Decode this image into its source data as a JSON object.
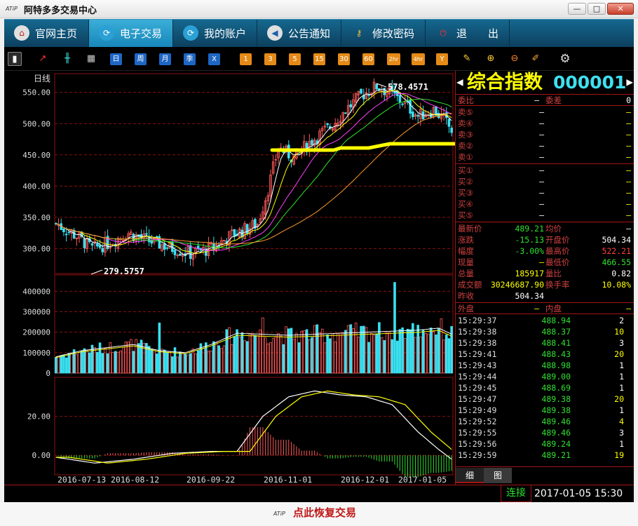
{
  "window": {
    "logo": "ATiP",
    "title": "阿特多多交易中心",
    "min": "—",
    "max": "□",
    "close": "✕"
  },
  "nav": [
    {
      "label": "官网主页",
      "icon": "home-icon"
    },
    {
      "label": "电子交易",
      "icon": "refresh-icon",
      "active": true
    },
    {
      "label": "我的账户",
      "icon": "refresh-icon"
    },
    {
      "label": "公告通知",
      "icon": "megaphone-icon"
    },
    {
      "label": "修改密码",
      "icon": "key-icon"
    },
    {
      "label": "退　　出",
      "icon": "power-icon"
    }
  ],
  "toolbar": {
    "periods": [
      "日",
      "周",
      "月",
      "季",
      "X"
    ],
    "minutes": [
      "1",
      "3",
      "5",
      "15",
      "30",
      "60",
      "2hr",
      "4hr",
      "Y"
    ]
  },
  "chart_data": {
    "type": "candlestick",
    "period_label": "日线",
    "price_axis": {
      "ticks": [
        "550.00",
        "500.00",
        "450.00",
        "400.00",
        "350.00",
        "300.00"
      ],
      "values": [
        550,
        500,
        450,
        400,
        350,
        300
      ],
      "ylim": [
        260,
        580
      ]
    },
    "volume_axis": {
      "ticks": [
        "400000",
        "300000",
        "200000",
        "100000",
        "0"
      ],
      "values": [
        400000,
        300000,
        200000,
        100000,
        0
      ],
      "ylim": [
        0,
        480000
      ]
    },
    "macd_axis": {
      "ticks": [
        "20.00",
        "0.00"
      ],
      "values": [
        20,
        0
      ],
      "ylim": [
        -10,
        40
      ]
    },
    "x_labels": [
      "2016-07-13",
      "2016-08-12",
      "2016-09-22",
      "2016-11-01",
      "2016-12-01",
      "2017-01-05"
    ],
    "annotations": [
      {
        "text": "578.4571",
        "kind": "high"
      },
      {
        "text": "279.5757",
        "kind": "low"
      }
    ],
    "colors": {
      "up": "#ff5a5a",
      "down": "#3ae0f0",
      "ma1": "#ffffff",
      "ma2": "#ffff00",
      "ma3": "#ff40ff",
      "ma4": "#30e030",
      "ma5": "#ff9a30",
      "highlight": "#ffff00",
      "grid": "#8a1010"
    },
    "series": [
      {
        "kp": [
          0,
          342
        ],
        "kp_end": [
          20,
          303
        ]
      },
      {
        "kp": [
          20,
          303
        ],
        "kp_end": [
          40,
          318
        ]
      }
    ],
    "price_keypoints": [
      [
        0,
        340
      ],
      [
        8,
        320
      ],
      [
        14,
        300
      ],
      [
        20,
        308
      ],
      [
        28,
        325
      ],
      [
        36,
        312
      ],
      [
        44,
        302
      ],
      [
        52,
        292
      ],
      [
        60,
        300
      ],
      [
        68,
        322
      ],
      [
        74,
        332
      ],
      [
        78,
        340
      ],
      [
        82,
        395
      ],
      [
        86,
        462
      ],
      [
        92,
        445
      ],
      [
        98,
        470
      ],
      [
        106,
        495
      ],
      [
        112,
        522
      ],
      [
        118,
        545
      ],
      [
        124,
        560
      ],
      [
        128,
        552
      ],
      [
        134,
        535
      ],
      [
        140,
        512
      ],
      [
        146,
        522
      ],
      [
        150,
        507
      ],
      [
        153,
        489
      ]
    ],
    "volume_keypoints": [
      [
        0,
        80000
      ],
      [
        10,
        110000
      ],
      [
        20,
        125000
      ],
      [
        30,
        140000
      ],
      [
        40,
        110000
      ],
      [
        50,
        100000
      ],
      [
        60,
        140000
      ],
      [
        70,
        195000
      ],
      [
        80,
        190000
      ],
      [
        90,
        185000
      ],
      [
        100,
        190000
      ],
      [
        110,
        195000
      ],
      [
        120,
        200000
      ],
      [
        130,
        205000
      ],
      [
        140,
        210000
      ],
      [
        148,
        220000
      ],
      [
        153,
        190000
      ]
    ],
    "macd_keypoints": [
      [
        0,
        -1
      ],
      [
        15,
        -4
      ],
      [
        30,
        -2
      ],
      [
        45,
        1
      ],
      [
        60,
        2
      ],
      [
        70,
        2
      ],
      [
        80,
        20
      ],
      [
        90,
        30
      ],
      [
        100,
        33
      ],
      [
        110,
        31
      ],
      [
        120,
        30
      ],
      [
        130,
        26
      ],
      [
        140,
        12
      ],
      [
        148,
        3
      ],
      [
        153,
        -2
      ]
    ]
  },
  "quote": {
    "name": "综合指数",
    "code": "000001",
    "arrow_left": "◀",
    "arrow_right": "▶",
    "ratio": {
      "label1": "委比",
      "val1": "—",
      "label2": "委差",
      "val2": "0"
    },
    "sell": [
      {
        "label": "卖⑤",
        "price": "—",
        "vol": "—"
      },
      {
        "label": "卖④",
        "price": "—",
        "vol": "—"
      },
      {
        "label": "卖③",
        "price": "—",
        "vol": "—"
      },
      {
        "label": "卖②",
        "price": "—",
        "vol": "—"
      },
      {
        "label": "卖①",
        "price": "—",
        "vol": "—"
      }
    ],
    "buy": [
      {
        "label": "买①",
        "price": "—",
        "vol": "—"
      },
      {
        "label": "买②",
        "price": "—",
        "vol": "—"
      },
      {
        "label": "买③",
        "price": "—",
        "vol": "—"
      },
      {
        "label": "买④",
        "price": "—",
        "vol": "—"
      },
      {
        "label": "买⑤",
        "price": "—",
        "vol": "—"
      }
    ],
    "stats": [
      {
        "l1": "最新价",
        "v1": "489.21",
        "c1": "#30e030",
        "l2": "均价",
        "v2": "—",
        "c2": "#ffffff"
      },
      {
        "l1": "涨跌",
        "v1": "-15.13",
        "c1": "#30e030",
        "l2": "开盘价",
        "v2": "504.34",
        "c2": "#ffffff"
      },
      {
        "l1": "幅度",
        "v1": "-3.00%",
        "c1": "#30e030",
        "l2": "最高价",
        "v2": "522.21",
        "c2": "#ff4040"
      },
      {
        "l1": "现量",
        "v1": "—",
        "c1": "#ffff00",
        "l2": "最低价",
        "v2": "466.55",
        "c2": "#30e030"
      },
      {
        "l1": "总量",
        "v1": "185917",
        "c1": "#ffff00",
        "l2": "量比",
        "v2": "0.82",
        "c2": "#ffffff"
      },
      {
        "l1": "成交额",
        "v1": "30246687.90",
        "c1": "#ffff00",
        "l2": "换手率",
        "v2": "10.08%",
        "c2": "#ffff00"
      },
      {
        "l1": "昨收",
        "v1": "504.34",
        "c1": "#ffffff",
        "l2": "",
        "v2": "",
        "c2": "#ffffff"
      }
    ],
    "outer": {
      "label1": "外盘",
      "val1": "—",
      "label2": "内盘",
      "val2": "—"
    },
    "trades": [
      {
        "time": "15:29:37",
        "price": "488.94",
        "vol": "2",
        "vc": "#ffffff"
      },
      {
        "time": "15:29:38",
        "price": "488.37",
        "vol": "10",
        "vc": "#ffff00"
      },
      {
        "time": "15:29:38",
        "price": "488.41",
        "vol": "3",
        "vc": "#ffffff"
      },
      {
        "time": "15:29:41",
        "price": "488.43",
        "vol": "20",
        "vc": "#ffff00"
      },
      {
        "time": "15:29:43",
        "price": "488.98",
        "vol": "1",
        "vc": "#ffffff"
      },
      {
        "time": "15:29:44",
        "price": "489.00",
        "vol": "1",
        "vc": "#ffffff"
      },
      {
        "time": "15:29:45",
        "price": "488.69",
        "vol": "1",
        "vc": "#ffffff"
      },
      {
        "time": "15:29:47",
        "price": "489.38",
        "vol": "20",
        "vc": "#ffff00"
      },
      {
        "time": "15:29:49",
        "price": "489.38",
        "vol": "1",
        "vc": "#ffffff"
      },
      {
        "time": "15:29:52",
        "price": "489.46",
        "vol": "4",
        "vc": "#ffff00"
      },
      {
        "time": "15:29:55",
        "price": "489.46",
        "vol": "3",
        "vc": "#ffffff"
      },
      {
        "time": "15:29:56",
        "price": "489.24",
        "vol": "1",
        "vc": "#ffffff"
      },
      {
        "time": "15:29:59",
        "price": "489.21",
        "vol": "19",
        "vc": "#ffff00"
      }
    ],
    "tabs": [
      "细",
      "图"
    ]
  },
  "status": {
    "connection": "连接",
    "datetime": "2017-01-05  15:30"
  },
  "bottom": {
    "logo": "ATiP",
    "text": "点此恢复交易"
  }
}
